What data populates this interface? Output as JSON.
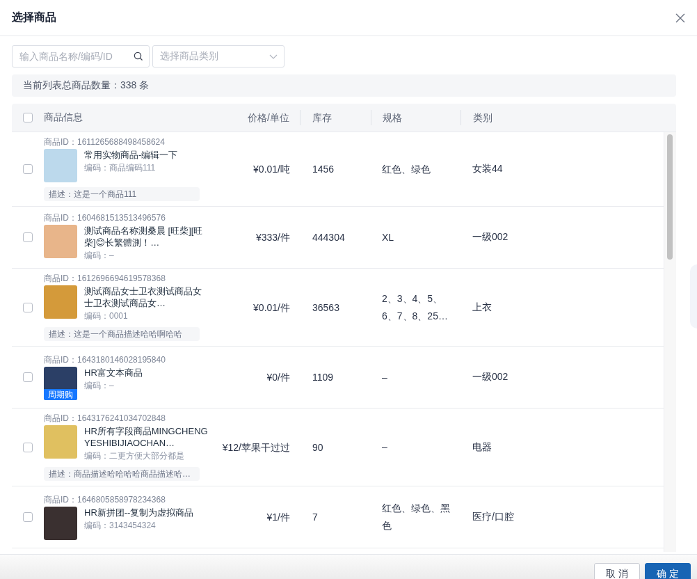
{
  "dialog": {
    "title": "选择商品"
  },
  "search": {
    "placeholder": "输入商品名称/编码/ID"
  },
  "category_select": {
    "placeholder": "选择商品类别"
  },
  "summary": "当前列表总商品数量：338 条",
  "table": {
    "select_all": {
      "checked": false
    },
    "columns": [
      "商品信息",
      "价格/单位",
      "库存",
      "规格",
      "类别"
    ],
    "rows": [
      {
        "checked": false,
        "id": "商品ID：1611265688498458624",
        "name": "常用实物商品-编辑一下",
        "code": "编码：商品编码111",
        "description": "描述：这是一个商品111",
        "price": "¥0.01/吨",
        "stock": "1456",
        "spec": "红色、绿色",
        "category": "女装44"
      },
      {
        "checked": false,
        "id": "商品ID：1604681513513496576",
        "name": "测试商品名称测桑晨 [旺柴][旺柴]😊长繁體測！…",
        "code": "编码：–",
        "price": "¥333/件",
        "stock": "444304",
        "spec": "XL",
        "category": "一级002"
      },
      {
        "checked": false,
        "id": "商品ID：1612696694619578368",
        "name": "测试商品女士卫衣测试商品女士卫衣测试商品女…",
        "code": "编码：0001",
        "description": "描述：这是一个商品描述哈哈啊哈哈",
        "price": "¥0.01/件",
        "stock": "36563",
        "spec": "2、3、4、5、6、7、8、25…",
        "category": "上衣"
      },
      {
        "checked": false,
        "id": "商品ID：1643180146028195840",
        "name": "HR富文本商品",
        "code": "编码：–",
        "badge": "周期购",
        "price": "¥0/件",
        "stock": "1109",
        "spec": "–",
        "category": "一级002"
      },
      {
        "checked": false,
        "id": "商品ID：1643176241034702848",
        "name": "HR所有字段商品MINGCHENGYESHIBIJIAOCHAN…",
        "code": "编码：二更方便大部分都是",
        "description": "描述：商品描述哈哈哈哈商品描述哈…",
        "price": "¥12/苹果干过过",
        "stock": "90",
        "spec": "–",
        "category": "电器"
      },
      {
        "checked": false,
        "id": "商品ID：1646805858978234368",
        "name": "HR新拼团--复制为虚拟商品",
        "code": "编码：3143454324",
        "price": "¥1/件",
        "stock": "7",
        "spec": "红色、绿色、黑色",
        "category": "医疗/口腔"
      }
    ]
  },
  "footer": {
    "buttons": [
      {
        "label": "取 消",
        "kind": "secondary"
      },
      {
        "label": "确 定",
        "kind": "primary"
      }
    ]
  }
}
